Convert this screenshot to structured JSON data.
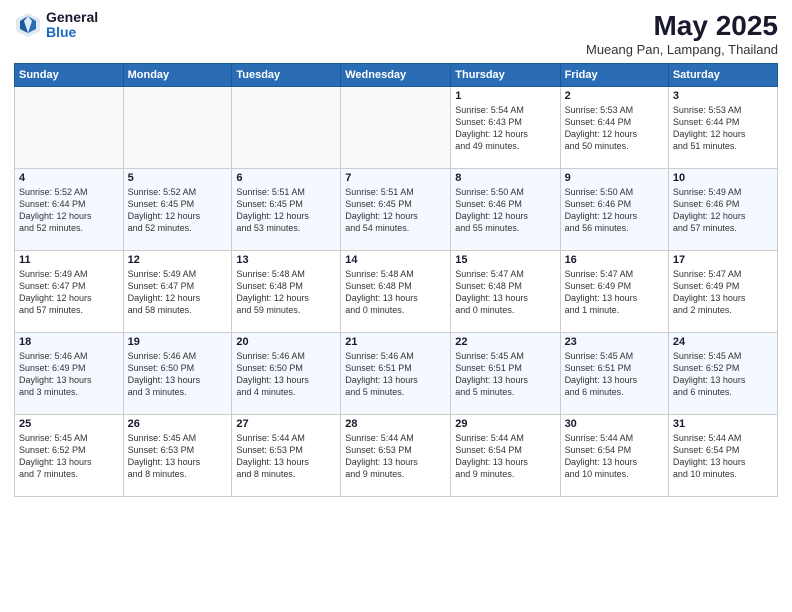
{
  "logo": {
    "general": "General",
    "blue": "Blue"
  },
  "header": {
    "title": "May 2025",
    "subtitle": "Mueang Pan, Lampang, Thailand"
  },
  "days_of_week": [
    "Sunday",
    "Monday",
    "Tuesday",
    "Wednesday",
    "Thursday",
    "Friday",
    "Saturday"
  ],
  "weeks": [
    [
      {
        "day": "",
        "info": ""
      },
      {
        "day": "",
        "info": ""
      },
      {
        "day": "",
        "info": ""
      },
      {
        "day": "",
        "info": ""
      },
      {
        "day": "1",
        "info": "Sunrise: 5:54 AM\nSunset: 6:43 PM\nDaylight: 12 hours\nand 49 minutes."
      },
      {
        "day": "2",
        "info": "Sunrise: 5:53 AM\nSunset: 6:44 PM\nDaylight: 12 hours\nand 50 minutes."
      },
      {
        "day": "3",
        "info": "Sunrise: 5:53 AM\nSunset: 6:44 PM\nDaylight: 12 hours\nand 51 minutes."
      }
    ],
    [
      {
        "day": "4",
        "info": "Sunrise: 5:52 AM\nSunset: 6:44 PM\nDaylight: 12 hours\nand 52 minutes."
      },
      {
        "day": "5",
        "info": "Sunrise: 5:52 AM\nSunset: 6:45 PM\nDaylight: 12 hours\nand 52 minutes."
      },
      {
        "day": "6",
        "info": "Sunrise: 5:51 AM\nSunset: 6:45 PM\nDaylight: 12 hours\nand 53 minutes."
      },
      {
        "day": "7",
        "info": "Sunrise: 5:51 AM\nSunset: 6:45 PM\nDaylight: 12 hours\nand 54 minutes."
      },
      {
        "day": "8",
        "info": "Sunrise: 5:50 AM\nSunset: 6:46 PM\nDaylight: 12 hours\nand 55 minutes."
      },
      {
        "day": "9",
        "info": "Sunrise: 5:50 AM\nSunset: 6:46 PM\nDaylight: 12 hours\nand 56 minutes."
      },
      {
        "day": "10",
        "info": "Sunrise: 5:49 AM\nSunset: 6:46 PM\nDaylight: 12 hours\nand 57 minutes."
      }
    ],
    [
      {
        "day": "11",
        "info": "Sunrise: 5:49 AM\nSunset: 6:47 PM\nDaylight: 12 hours\nand 57 minutes."
      },
      {
        "day": "12",
        "info": "Sunrise: 5:49 AM\nSunset: 6:47 PM\nDaylight: 12 hours\nand 58 minutes."
      },
      {
        "day": "13",
        "info": "Sunrise: 5:48 AM\nSunset: 6:48 PM\nDaylight: 12 hours\nand 59 minutes."
      },
      {
        "day": "14",
        "info": "Sunrise: 5:48 AM\nSunset: 6:48 PM\nDaylight: 13 hours\nand 0 minutes."
      },
      {
        "day": "15",
        "info": "Sunrise: 5:47 AM\nSunset: 6:48 PM\nDaylight: 13 hours\nand 0 minutes."
      },
      {
        "day": "16",
        "info": "Sunrise: 5:47 AM\nSunset: 6:49 PM\nDaylight: 13 hours\nand 1 minute."
      },
      {
        "day": "17",
        "info": "Sunrise: 5:47 AM\nSunset: 6:49 PM\nDaylight: 13 hours\nand 2 minutes."
      }
    ],
    [
      {
        "day": "18",
        "info": "Sunrise: 5:46 AM\nSunset: 6:49 PM\nDaylight: 13 hours\nand 3 minutes."
      },
      {
        "day": "19",
        "info": "Sunrise: 5:46 AM\nSunset: 6:50 PM\nDaylight: 13 hours\nand 3 minutes."
      },
      {
        "day": "20",
        "info": "Sunrise: 5:46 AM\nSunset: 6:50 PM\nDaylight: 13 hours\nand 4 minutes."
      },
      {
        "day": "21",
        "info": "Sunrise: 5:46 AM\nSunset: 6:51 PM\nDaylight: 13 hours\nand 5 minutes."
      },
      {
        "day": "22",
        "info": "Sunrise: 5:45 AM\nSunset: 6:51 PM\nDaylight: 13 hours\nand 5 minutes."
      },
      {
        "day": "23",
        "info": "Sunrise: 5:45 AM\nSunset: 6:51 PM\nDaylight: 13 hours\nand 6 minutes."
      },
      {
        "day": "24",
        "info": "Sunrise: 5:45 AM\nSunset: 6:52 PM\nDaylight: 13 hours\nand 6 minutes."
      }
    ],
    [
      {
        "day": "25",
        "info": "Sunrise: 5:45 AM\nSunset: 6:52 PM\nDaylight: 13 hours\nand 7 minutes."
      },
      {
        "day": "26",
        "info": "Sunrise: 5:45 AM\nSunset: 6:53 PM\nDaylight: 13 hours\nand 8 minutes."
      },
      {
        "day": "27",
        "info": "Sunrise: 5:44 AM\nSunset: 6:53 PM\nDaylight: 13 hours\nand 8 minutes."
      },
      {
        "day": "28",
        "info": "Sunrise: 5:44 AM\nSunset: 6:53 PM\nDaylight: 13 hours\nand 9 minutes."
      },
      {
        "day": "29",
        "info": "Sunrise: 5:44 AM\nSunset: 6:54 PM\nDaylight: 13 hours\nand 9 minutes."
      },
      {
        "day": "30",
        "info": "Sunrise: 5:44 AM\nSunset: 6:54 PM\nDaylight: 13 hours\nand 10 minutes."
      },
      {
        "day": "31",
        "info": "Sunrise: 5:44 AM\nSunset: 6:54 PM\nDaylight: 13 hours\nand 10 minutes."
      }
    ]
  ]
}
